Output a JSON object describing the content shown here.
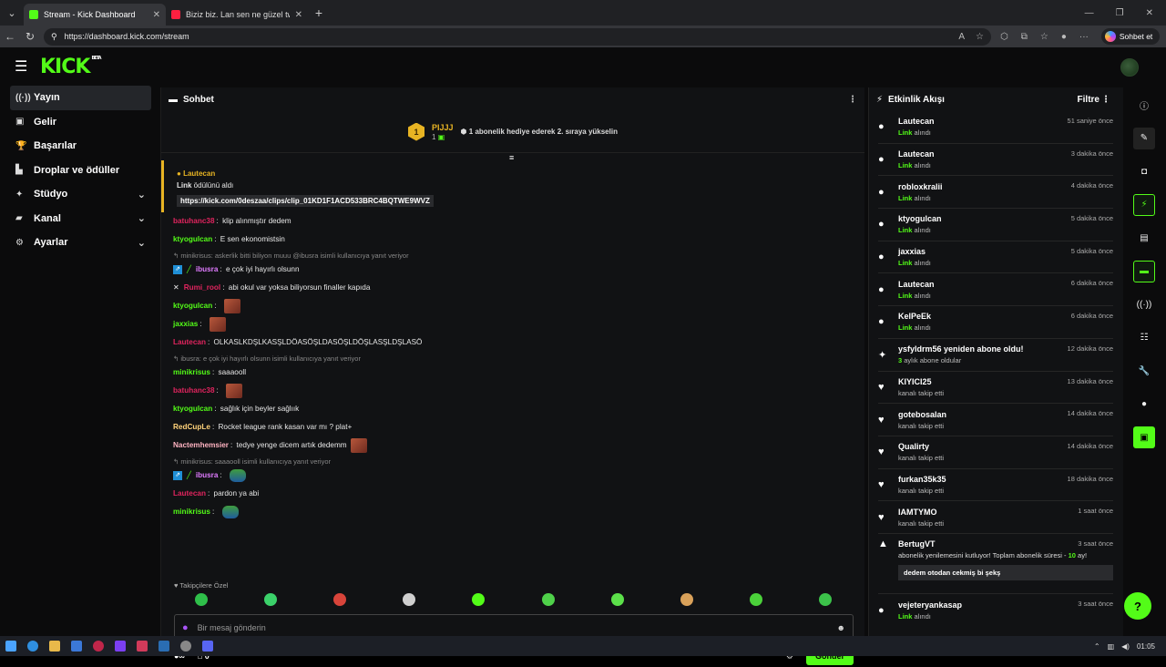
{
  "browser": {
    "tabs": [
      {
        "title": "Stream - Kick Dashboard",
        "color": "#53fc18",
        "active": true
      },
      {
        "title": "Biziz biz. Lan sen ne güzel tweetle",
        "color": "#ff2040",
        "active": false
      }
    ],
    "url": "https://dashboard.kick.com/stream",
    "chat_button": "Sohbet et"
  },
  "app": {
    "logo": "KICK",
    "beta": "BETA"
  },
  "sidebar": {
    "items": [
      {
        "label": "Yayın",
        "icon": "broadcast-icon",
        "glyph": "((·))",
        "active": true,
        "chevron": false
      },
      {
        "label": "Gelir",
        "icon": "revenue-icon",
        "glyph": "▣",
        "chevron": false
      },
      {
        "label": "Başarılar",
        "icon": "trophy-icon",
        "glyph": "🏆",
        "chevron": false
      },
      {
        "label": "Droplar ve ödüller",
        "icon": "drops-icon",
        "glyph": "▙",
        "chevron": false
      },
      {
        "label": "Stüdyo",
        "icon": "studio-icon",
        "glyph": "✦",
        "chevron": true
      },
      {
        "label": "Kanal",
        "icon": "channel-icon",
        "glyph": "▰",
        "chevron": true
      },
      {
        "label": "Ayarlar",
        "icon": "settings-icon",
        "glyph": "⚙",
        "chevron": true
      }
    ]
  },
  "chat": {
    "title": "Sohbet",
    "pinned": {
      "rank": "1",
      "name": "PIJJJ",
      "count": "1",
      "text": "1 abonelik hediye ederek 2. sıraya yükselin"
    },
    "reward": {
      "user": "Lautecan",
      "line_bold": "Link",
      "line_rest": " ödülünü aldı",
      "link": "https://kick.com/0deszaa/clips/clip_01KD1F1ACD533BRC4BQTWE9WVZ"
    },
    "messages": [
      {
        "user": "batuhanc38",
        "color": "#e0245e",
        "text": "klip alınmıştır dedem"
      },
      {
        "user": "ktyogulcan",
        "color": "#53fc18",
        "text": "E sen ekonomistsin"
      },
      {
        "reply": "minikrisus: askerlik bitti biliyon muuu @ibusra isimli kullanıcıya yanıt veriyor"
      },
      {
        "user": "ibusra",
        "color": "#e07bff",
        "text": "e çok iyi hayırlı olsunn",
        "badges": "mod"
      },
      {
        "user": "Rumi_rool",
        "color": "#e0245e",
        "text": "abi okul var yoksa biliyorsun finaller kapıda",
        "badges": "sword"
      },
      {
        "user": "ktyogulcan",
        "color": "#53fc18",
        "text": "",
        "emote": "face"
      },
      {
        "user": "jaxxias",
        "color": "#53fc18",
        "text": "",
        "emote": "face"
      },
      {
        "user": "Lautecan",
        "color": "#e0245e",
        "text": "OLKASLKDŞLKASŞLDÖASÖŞLDASÖŞLDÖŞLASŞLDŞLASÖ"
      },
      {
        "reply": "ibusra: e çok iyi hayırlı olsunn isimli kullanıcıya yanıt veriyor"
      },
      {
        "user": "minikrisus",
        "color": "#53fc18",
        "text": "saaaooll"
      },
      {
        "user": "batuhanc38",
        "color": "#e0245e",
        "text": "",
        "emote": "face"
      },
      {
        "user": "ktyogulcan",
        "color": "#53fc18",
        "text": "sağlık için beyler sağlıık"
      },
      {
        "user": "RedCupLe",
        "color": "#ffd27a",
        "text": "Rocket league rank kasan var mı ? plat+"
      },
      {
        "user": "Nactemhemsier",
        "color": "#ffb3c1",
        "text": "tedye yenge dicem artık dedemm",
        "emote": "face"
      },
      {
        "reply": "minikrisus: saaaooll isimli kullanıcıya yanıt veriyor"
      },
      {
        "user": "ibusra",
        "color": "#e07bff",
        "text": "",
        "badges": "mod",
        "emote": "pepe"
      },
      {
        "user": "Lautecan",
        "color": "#e0245e",
        "text": "pardon ya abi"
      },
      {
        "user": "minikrisus",
        "color": "#53fc18",
        "text": "",
        "emote": "pepe"
      }
    ],
    "followers_only": "Takipçilere Özel",
    "input_placeholder": "Bir mesaj gönderin",
    "footer_count": "0",
    "send_label": "Gönder"
  },
  "feed": {
    "title": "Etkinlik Akışı",
    "filter": "Filtre",
    "items": [
      {
        "name": "Lautecan",
        "sub_bold": "Link",
        "sub": " alındı",
        "time": "51 saniye önce",
        "icon": "drop-icon"
      },
      {
        "name": "Lautecan",
        "sub_bold": "Link",
        "sub": " alındı",
        "time": "3 dakika önce",
        "icon": "drop-icon"
      },
      {
        "name": "robloxkralii",
        "sub_bold": "Link",
        "sub": " alındı",
        "time": "4 dakika önce",
        "icon": "drop-icon"
      },
      {
        "name": "ktyogulcan",
        "sub_bold": "Link",
        "sub": " alındı",
        "time": "5 dakika önce",
        "icon": "drop-icon"
      },
      {
        "name": "jaxxias",
        "sub_bold": "Link",
        "sub": " alındı",
        "time": "5 dakika önce",
        "icon": "drop-icon"
      },
      {
        "name": "Lautecan",
        "sub_bold": "Link",
        "sub": " alındı",
        "time": "6 dakika önce",
        "icon": "drop-icon"
      },
      {
        "name": "KelPeEk",
        "sub_bold": "Link",
        "sub": " alındı",
        "time": "6 dakika önce",
        "icon": "drop-icon"
      },
      {
        "name": "ysfyldrm56 yeniden abone oldu!",
        "sub_bold": "3",
        "sub": " aylık abone oldular",
        "time": "12 dakika önce",
        "icon": "sparkle-icon"
      },
      {
        "name": "KIYICI25",
        "sub_bold": "",
        "sub": "kanalı takip etti",
        "time": "13 dakika önce",
        "icon": "heart-icon"
      },
      {
        "name": "gotebosalan",
        "sub_bold": "",
        "sub": "kanalı takip etti",
        "time": "14 dakika önce",
        "icon": "heart-icon"
      },
      {
        "name": "Qualirty",
        "sub_bold": "",
        "sub": "kanalı takip etti",
        "time": "14 dakika önce",
        "icon": "heart-icon"
      },
      {
        "name": "furkan35k35",
        "sub_bold": "",
        "sub": "kanalı takip etti",
        "time": "18 dakika önce",
        "icon": "heart-icon"
      },
      {
        "name": "IAMTYMO",
        "sub_bold": "",
        "sub": "kanalı takip etti",
        "time": "1 saat önce",
        "icon": "heart-icon"
      }
    ],
    "resub": {
      "name": "BertugVT",
      "text": "abonelik yenilemesini kutluyor! Toplam abonelik süresi - ",
      "months": "10",
      "text2": " ay!",
      "quote": "dedem otodan cekmiş bi şekş",
      "time": "3 saat önce"
    },
    "last": {
      "name": "vejeteryankasap",
      "sub_bold": "Link",
      "sub": " alındı",
      "time": "3 saat önce"
    }
  },
  "taskbar": {
    "time": "01:05"
  }
}
